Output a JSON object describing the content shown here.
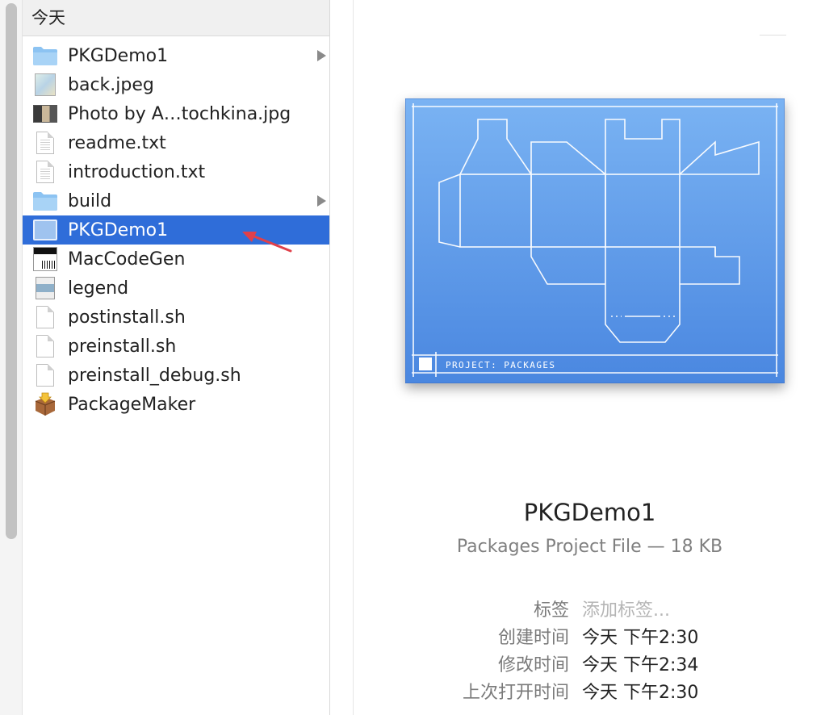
{
  "sidebar": {
    "section_label": "今天",
    "items": [
      {
        "name": "PKGDemo1",
        "icon": "folder-icon",
        "expandable": true,
        "selected": false
      },
      {
        "name": "back.jpeg",
        "icon": "image-thumbnail-icon",
        "expandable": false,
        "selected": false
      },
      {
        "name": "Photo by A…tochkina.jpg",
        "icon": "photo-thumbnail-icon",
        "expandable": false,
        "selected": false
      },
      {
        "name": "readme.txt",
        "icon": "text-document-icon",
        "expandable": false,
        "selected": false
      },
      {
        "name": "introduction.txt",
        "icon": "text-document-icon",
        "expandable": false,
        "selected": false
      },
      {
        "name": "build",
        "icon": "folder-icon",
        "expandable": true,
        "selected": false
      },
      {
        "name": "PKGDemo1",
        "icon": "packages-project-icon",
        "expandable": false,
        "selected": true
      },
      {
        "name": "MacCodeGen",
        "icon": "app-thumbnail-icon",
        "expandable": false,
        "selected": false
      },
      {
        "name": "legend",
        "icon": "legend-thumbnail-icon",
        "expandable": false,
        "selected": false
      },
      {
        "name": "postinstall.sh",
        "icon": "blank-document-icon",
        "expandable": false,
        "selected": false
      },
      {
        "name": "preinstall.sh",
        "icon": "blank-document-icon",
        "expandable": false,
        "selected": false
      },
      {
        "name": "preinstall_debug.sh",
        "icon": "blank-document-icon",
        "expandable": false,
        "selected": false
      },
      {
        "name": "PackageMaker",
        "icon": "package-maker-icon",
        "expandable": false,
        "selected": false
      }
    ]
  },
  "preview": {
    "blueprint_caption": "PROJECT: PACKAGES",
    "file_name": "PKGDemo1",
    "file_kind_size": "Packages Project File — 18 KB",
    "metadata": [
      {
        "label": "标签",
        "value": "添加标签...",
        "placeholder": true
      },
      {
        "label": "创建时间",
        "value": "今天 下午2:30",
        "placeholder": false
      },
      {
        "label": "修改时间",
        "value": "今天 下午2:34",
        "placeholder": false
      },
      {
        "label": "上次打开时间",
        "value": "今天 下午2:30",
        "placeholder": false
      }
    ]
  },
  "colors": {
    "selection": "#2f6dd9",
    "folder": "#8cc3f2",
    "blueprint_top": "#7ab3f3",
    "blueprint_bottom": "#4a87e0",
    "annotation_arrow": "#e0404a"
  }
}
